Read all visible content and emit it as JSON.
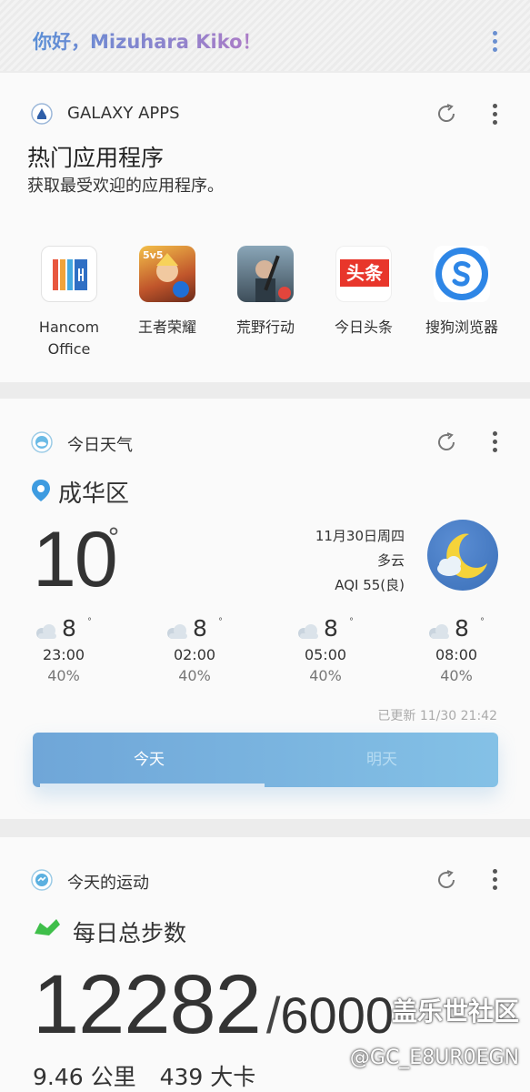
{
  "greeting": "你好，Mizuhara Kiko！",
  "galaxy_apps": {
    "title": "GALAXY APPS",
    "heading": "热门应用程序",
    "subheading": "获取最受欢迎的应用程序。",
    "apps": [
      {
        "label": "Hancom Office",
        "icon": "hancom-office-icon"
      },
      {
        "label": "王者荣耀",
        "icon": "honor-of-kings-icon"
      },
      {
        "label": "荒野行动",
        "icon": "knives-out-icon"
      },
      {
        "label": "今日头条",
        "icon": "toutiao-icon",
        "icon_text": "头条"
      },
      {
        "label": "搜狗浏览器",
        "icon": "sogou-browser-icon"
      }
    ]
  },
  "weather": {
    "title": "今日天气",
    "location": "成华区",
    "temperature": "10",
    "degree": "°",
    "date": "11月30日周四",
    "condition": "多云",
    "aqi": "AQI 55(良)",
    "hourly": [
      {
        "temp": "8",
        "time": "23:00",
        "precip": "40%"
      },
      {
        "temp": "8",
        "time": "02:00",
        "precip": "40%"
      },
      {
        "temp": "8",
        "time": "05:00",
        "precip": "40%"
      },
      {
        "temp": "8",
        "time": "08:00",
        "precip": "40%"
      }
    ],
    "updated": "已更新 11/30 21:42",
    "tabs": [
      "今天",
      "明天"
    ],
    "selected_tab": "今天"
  },
  "exercise": {
    "title": "今天的运动",
    "steps_title": "每日总步数",
    "steps": "12282",
    "separator": "/",
    "goal": "6000",
    "distance": "9.46 公里",
    "calories": "439 大卡"
  },
  "watermark": {
    "line1": "盖乐世社区",
    "line2": "@GC_E8UR0EGN"
  },
  "colors": {
    "accent_blue": "#5a8fd6",
    "accent_purple": "#b07bc6",
    "tab_gradient_start": "#6fa6d8",
    "tab_gradient_end": "#84c1e6",
    "shoe_green": "#3fbf4a"
  }
}
